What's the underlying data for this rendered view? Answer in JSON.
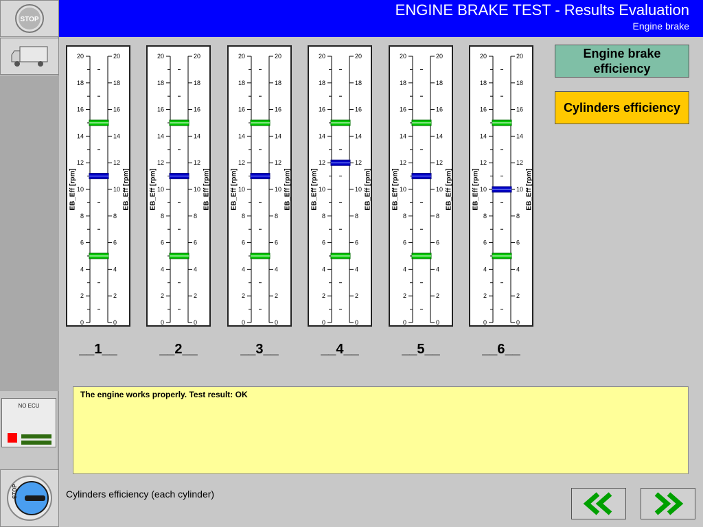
{
  "header": {
    "title": "ENGINE BRAKE TEST - Results Evaluation",
    "subtitle": "Engine brake"
  },
  "sidebar": {
    "stop_label": "STOP",
    "ecu_label": "NO ECU",
    "stop_bottom_label": "STOP"
  },
  "gauge": {
    "axis_label": "EB_Eff [rpm]",
    "ticks": [
      "0",
      "2",
      "4",
      "6",
      "8",
      "10",
      "12",
      "14",
      "16",
      "18",
      "20"
    ],
    "min": 0,
    "max": 20,
    "lower_limit": 5,
    "upper_limit": 15,
    "limit_color": "#00c800",
    "value_color": "#0000c8"
  },
  "cylinders": [
    {
      "label": "__1__",
      "value": 11
    },
    {
      "label": "__2__",
      "value": 11
    },
    {
      "label": "__3__",
      "value": 11
    },
    {
      "label": "__4__",
      "value": 12
    },
    {
      "label": "__5__",
      "value": 11
    },
    {
      "label": "__6__",
      "value": 10
    }
  ],
  "buttons": {
    "engine_brake_efficiency": "Engine brake efficiency",
    "cylinders_efficiency": "Cylinders efficiency"
  },
  "message": "The engine works properly. Test result: OK",
  "status": "Cylinders efficiency (each cylinder)",
  "colors": {
    "header_bg": "#0000ff",
    "message_bg": "#ffff99",
    "eb_button_bg": "#7fbfa6",
    "cyl_button_bg": "#ffc800",
    "nav_arrow": "#00a000"
  }
}
